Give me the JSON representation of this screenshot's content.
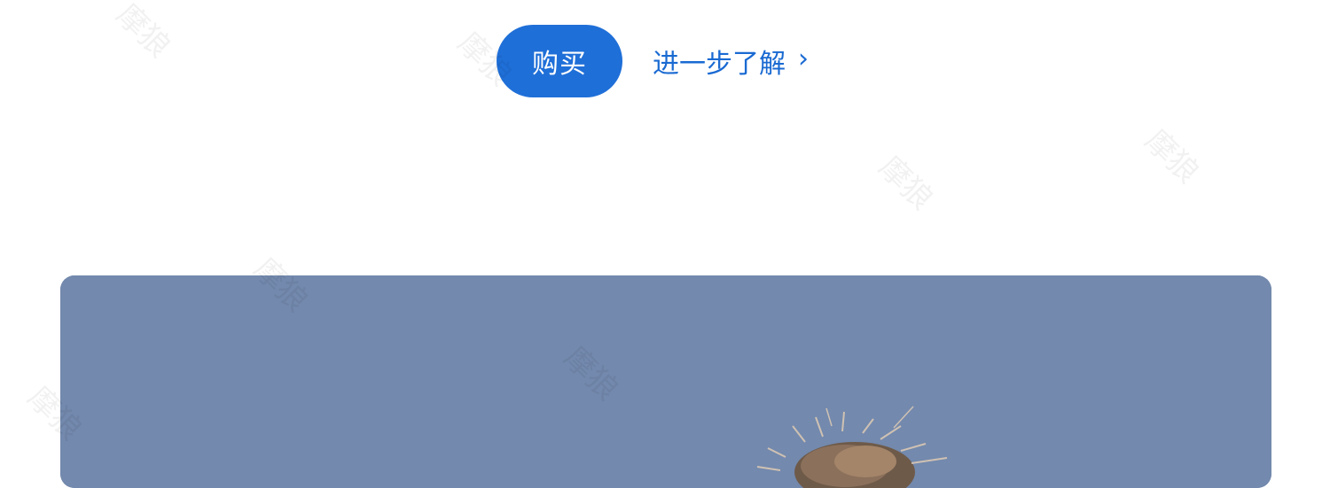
{
  "cta": {
    "buy_label": "购买",
    "learn_more_label": "进一步了解",
    "learn_more_chevron": "›"
  },
  "hero": {
    "background_color": "#7389ad",
    "image_subject": "person-hair"
  },
  "colors": {
    "accent": "#1f6fd8",
    "link": "#1a6ad2"
  },
  "watermark": {
    "text": "摩狼"
  }
}
